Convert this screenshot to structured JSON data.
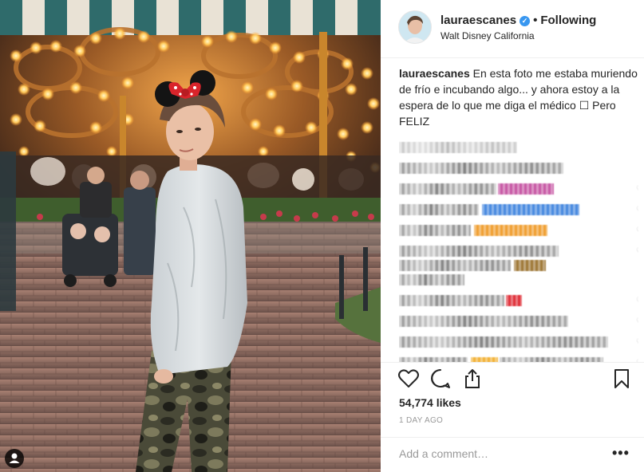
{
  "post": {
    "username": "lauraescanes",
    "verified_icon": "verified-badge-icon",
    "separator": "•",
    "follow_label": "Following",
    "location": "Walt Disney California",
    "caption_username": "lauraescanes",
    "caption_text": "En esta foto me estaba muriendo de frío e incubando algo... y ahora estoy a la espera de lo que me diga el médico ☐ Pero FELIZ",
    "likes": "54,774 likes",
    "time": "1 DAY AGO",
    "comment_placeholder": "Add a comment…",
    "more_label": "•••"
  },
  "icons": {
    "like": "heart-outline-icon",
    "comment": "comment-bubble-icon",
    "share": "share-icon",
    "save": "bookmark-icon",
    "tagged": "person-tag-icon"
  },
  "colors": {
    "verified": "#3897f0",
    "text": "#262626",
    "muted": "#999999",
    "divider": "#efefef"
  }
}
